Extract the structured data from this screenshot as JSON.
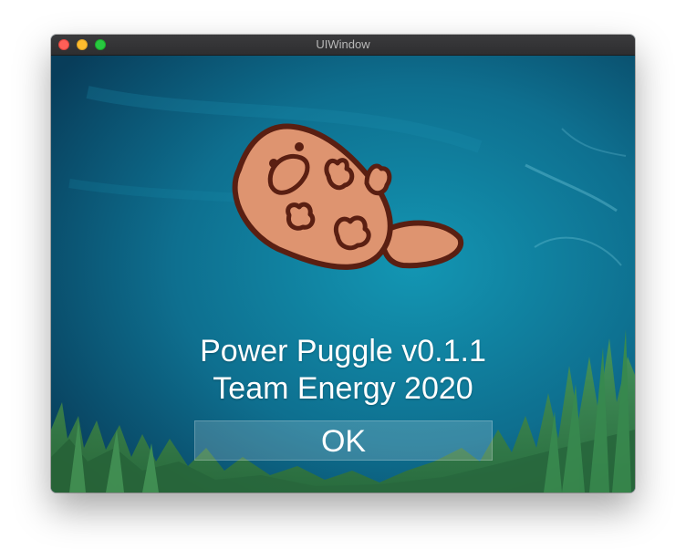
{
  "window": {
    "title": "UIWindow"
  },
  "about": {
    "line1": "Power Puggle v0.1.1",
    "line2": "Team Energy 2020",
    "ok_label": "OK"
  },
  "colors": {
    "ocean_top": "#0a4563",
    "ocean_bottom": "#0f7f9a",
    "platypus_body": "#de9470",
    "platypus_outline": "#5a1f12",
    "grass": "#3f8a43",
    "close": "#fe5f57",
    "minimize": "#febc2e",
    "maximize": "#28c840"
  },
  "icons": {
    "logo": "platypus-logo"
  }
}
